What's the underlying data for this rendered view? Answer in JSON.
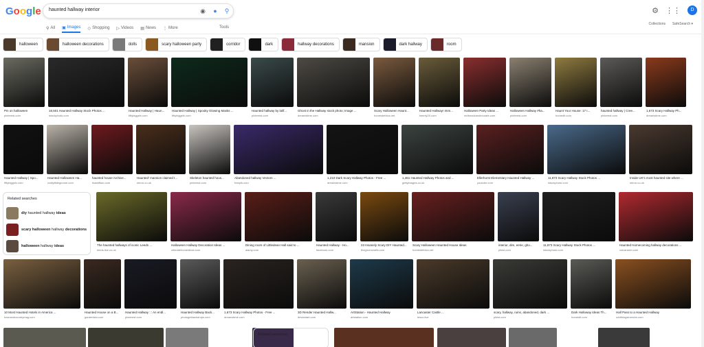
{
  "search": {
    "query": "haunted hallway interior"
  },
  "logo": {
    "letters": [
      "G",
      "o",
      "o",
      "g",
      "l",
      "e"
    ],
    "colors": [
      "#4285f4",
      "#ea4335",
      "#fbbc05",
      "#4285f4",
      "#34a853",
      "#ea4335"
    ]
  },
  "tabs": [
    {
      "label": "All",
      "icon": "search-icon",
      "active": false
    },
    {
      "label": "Images",
      "icon": "image-icon",
      "active": true
    },
    {
      "label": "Shopping",
      "icon": "tag-icon",
      "active": false
    },
    {
      "label": "Videos",
      "icon": "play-icon",
      "active": false
    },
    {
      "label": "News",
      "icon": "news-icon",
      "active": false
    },
    {
      "label": "More",
      "icon": "more-icon",
      "active": false
    }
  ],
  "tools_label": "Tools",
  "collections_label": "Collections",
  "safesearch_label": "SafeSearch ▾",
  "avatar_letter": "D",
  "chips": [
    "halloween",
    "halloween decorations",
    "dolls",
    "scary halloween party",
    "corridor",
    "dark",
    "hallway decorations",
    "mansion",
    "dark hallway",
    "room"
  ],
  "row1": [
    {
      "cap": "Pin on halloween",
      "src": "pinterest.com",
      "color": "#6b6b62"
    },
    {
      "cap": "18,501 Haunted Hallway Stock Photos ...",
      "src": "istockphoto.com",
      "color": "#2a2a2a"
    },
    {
      "cap": "Haunted Hallway | Haun...",
      "src": "fiftybiggsfx.com",
      "color": "#6a4e3a"
    },
    {
      "cap": "Haunted Hallway | Spooky Glowing Masks ...",
      "src": "fiftybiggsfx.com",
      "color": "#0e2a1c"
    },
    {
      "cap": "Haunted hallway by lalif...",
      "src": "pinterest.com",
      "color": "#3b4a4a"
    },
    {
      "cap": "Ghost in the Hallway stock photo; Image ...",
      "src": "dreamstime.com",
      "color": "#4d4a44"
    },
    {
      "cap": "Scary Halloween Haunt...",
      "src": "homestethics.net",
      "color": "#7a5a3e"
    },
    {
      "cap": "Haunted Hallway! Imm...",
      "src": "twenty20.com",
      "color": "#6a5c3a"
    },
    {
      "cap": "Halloween Party Ideas ...",
      "src": "redheadcandecorate.com",
      "color": "#8a2e2e"
    },
    {
      "cap": "Halloween Hallway #ha...",
      "src": "pinterest.com",
      "color": "#8a8070"
    },
    {
      "cap": "Haunt Your House: 17 I...",
      "src": "homedit.com",
      "color": "#8f7b40"
    },
    {
      "cap": "haunted hallway | Cree...",
      "src": "pinterest.com",
      "color": "#5c5a58"
    },
    {
      "cap": "1,673 Scary Hallway Ph...",
      "src": "dreamstime.com",
      "color": "#8a3a1c"
    }
  ],
  "row2": [
    {
      "cap": "Haunted Hallway | Spo...",
      "src": "fiftybiggsfx.com",
      "color": "#111111"
    },
    {
      "cap": "Haunted Halloween Ha...",
      "src": "craftylittlegnome.com",
      "color": "#b9b2a8"
    },
    {
      "cap": "haunted house Archive...",
      "src": "thatdiffoto.com",
      "color": "#6e1a1e"
    },
    {
      "cap": "Haunted' mansion claimed t...",
      "src": "mirror.co.uk",
      "color": "#4a2e1c"
    },
    {
      "cap": "Skeleton haunted hous...",
      "src": "pinterest.com",
      "color": "#c8c4bf"
    },
    {
      "cap": "Abandoned hallway Vectors ...",
      "src": "freepik.com",
      "color": "#3a2a6a"
    },
    {
      "cap": "1,210 Dark Scary Hallway Photos - Free ...",
      "src": "dreamstime.com",
      "color": "#141414"
    },
    {
      "cap": "1,461 Haunted Hallway Photos and ...",
      "src": "gettyimages.co.uk",
      "color": "#3c4440"
    },
    {
      "cap": "Ellerhorst Elementary Haunted Hallway ...",
      "src": "youtube.com",
      "color": "#5a2020"
    },
    {
      "cap": "11,873 Scary Hallway Stock Photos ...",
      "src": "istockphoto.com",
      "color": "#4a6a8a"
    },
    {
      "cap": "Inside UK's most haunted site where ...",
      "src": "mirror.co.uk",
      "color": "#4a3a30"
    }
  ],
  "related_title": "Related searches",
  "related_items": [
    {
      "bold": "diy",
      "rest": " haunted hallway ",
      "bold2": "ideas",
      "color": "#8a7a60"
    },
    {
      "bold": "scary halloween",
      "rest": " hallway ",
      "bold2": "decorations",
      "color": "#7a2020"
    },
    {
      "bold": "halloween",
      "rest": " hallway ",
      "bold2": "ideas",
      "color": "#5a4a40"
    }
  ],
  "row3": [
    {
      "cap": "The haunted hallways of iconic Leeds ...",
      "src": "leeds-live.co.uk",
      "color": "#6a6a2a"
    },
    {
      "cap": "Halloween Hallway Decoration Ideas ...",
      "src": "ultimatehomeideas.com",
      "color": "#8a2a4a"
    },
    {
      "cap": "Dining room of Littledean Hall said to ...",
      "src": "alamy.com",
      "color": "#5a1e18"
    },
    {
      "cap": "Haunted Hallway - Ho...",
      "src": "facebook.com",
      "color": "#3a3a3a"
    },
    {
      "cap": "23 Insanely Scary DIY Haunted...",
      "src": "thegruencrafts.com",
      "color": "#7a4a10"
    },
    {
      "cap": "Scary Halloween Haunted House Ideas",
      "src": "homestethics.net",
      "color": "#6a2020"
    },
    {
      "cap": "interior, dim, eerie, gho...",
      "src": "pikist.com",
      "color": "#3a4050"
    },
    {
      "cap": "11,873 Scary Hallway Stock Photos ...",
      "src": "istockphoto.com",
      "color": "#202020"
    },
    {
      "cap": "Haunted Homecoming hallway decorations ...",
      "src": "volcanicier.com",
      "color": "#b02a30"
    }
  ],
  "row4": [
    {
      "cap": "10 Most Haunted Hotels in America ...",
      "src": "townandcountrymag.com",
      "color": "#7a6040"
    },
    {
      "cap": "Haunted House on a B...",
      "src": "gardenista.com",
      "color": "#3a2a20"
    },
    {
      "cap": "Haunted Hallway ::: An endl...",
      "src": "pinterest.com",
      "color": "#1a1a24"
    },
    {
      "cap": "Haunted Hallway Back...",
      "src": "photogetbackdrops.com",
      "color": "#5a5a5a"
    },
    {
      "cap": "1,673 Scary Hallway Photos - Free ...",
      "src": "dreamstime.com",
      "color": "#2a2420"
    },
    {
      "cap": "3D Render Haunted Hallw...",
      "src": "deviantart.com",
      "color": "#6a6050"
    },
    {
      "cap": "ArtStation - Haunted Hallway",
      "src": "artstation.com",
      "color": "#1e3a4a"
    },
    {
      "cap": "Lancaster Castle ...",
      "src": "lesco.live",
      "color": "#4a3a2a"
    },
    {
      "cap": "scary, hallway, ruins, abandoned, dark ...",
      "src": "pikist.com",
      "color": "#3a3a36"
    },
    {
      "cap": "Dark Halloway Ideas Th...",
      "src": "homedit.com",
      "color": "#5a5a56"
    },
    {
      "cap": "Hall Pass to a Haunted Hallway",
      "src": "oddthingsineewin.com",
      "color": "#8a5020"
    }
  ],
  "row5_colors": [
    "#5a5a50",
    "#3a3a30",
    "#7a7a7a",
    "#2a3a4a",
    "#3a2a4a",
    "#5a3020",
    "#4a4040",
    "#6a6a6a",
    "#3a3a3a"
  ],
  "related2_title": "Related searches"
}
